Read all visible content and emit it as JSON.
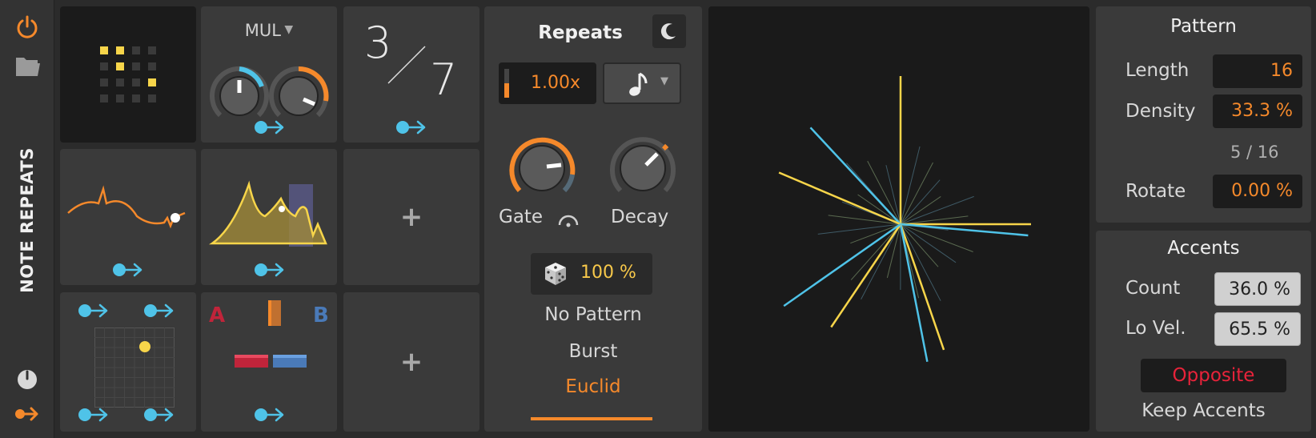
{
  "device_title": "NOTE REPEATS",
  "modulators": {
    "mul_label": "MUL",
    "fraction_top": "3",
    "fraction_bottom": "7",
    "ab_a": "A",
    "ab_b": "B"
  },
  "repeats": {
    "title": "Repeats",
    "rate_value": "1.00x",
    "gate_label": "Gate",
    "decay_label": "Decay",
    "chance_value": "100 %",
    "modes": [
      "No Pattern",
      "Burst",
      "Euclid"
    ],
    "active_mode": "Euclid"
  },
  "pattern": {
    "title": "Pattern",
    "length_label": "Length",
    "length_value": "16",
    "density_label": "Density",
    "density_value": "33.3 %",
    "ratio": "5 / 16",
    "rotate_label": "Rotate",
    "rotate_value": "0.00 %"
  },
  "accents": {
    "title": "Accents",
    "count_label": "Count",
    "count_value": "36.0 %",
    "lovel_label": "Lo Vel.",
    "lovel_value": "65.5 %",
    "opposite_label": "Opposite",
    "keep_label": "Keep Accents"
  },
  "colors": {
    "accent_orange": "#f5892b",
    "accent_blue": "#4fc3e8",
    "accent_yellow": "#f7d54a",
    "accent_red": "#e8233a"
  },
  "icons": [
    "power-icon",
    "folder-icon",
    "dice-icon",
    "moon-icon",
    "note-icon",
    "modulation-arrow-icon",
    "dial-icon"
  ]
}
